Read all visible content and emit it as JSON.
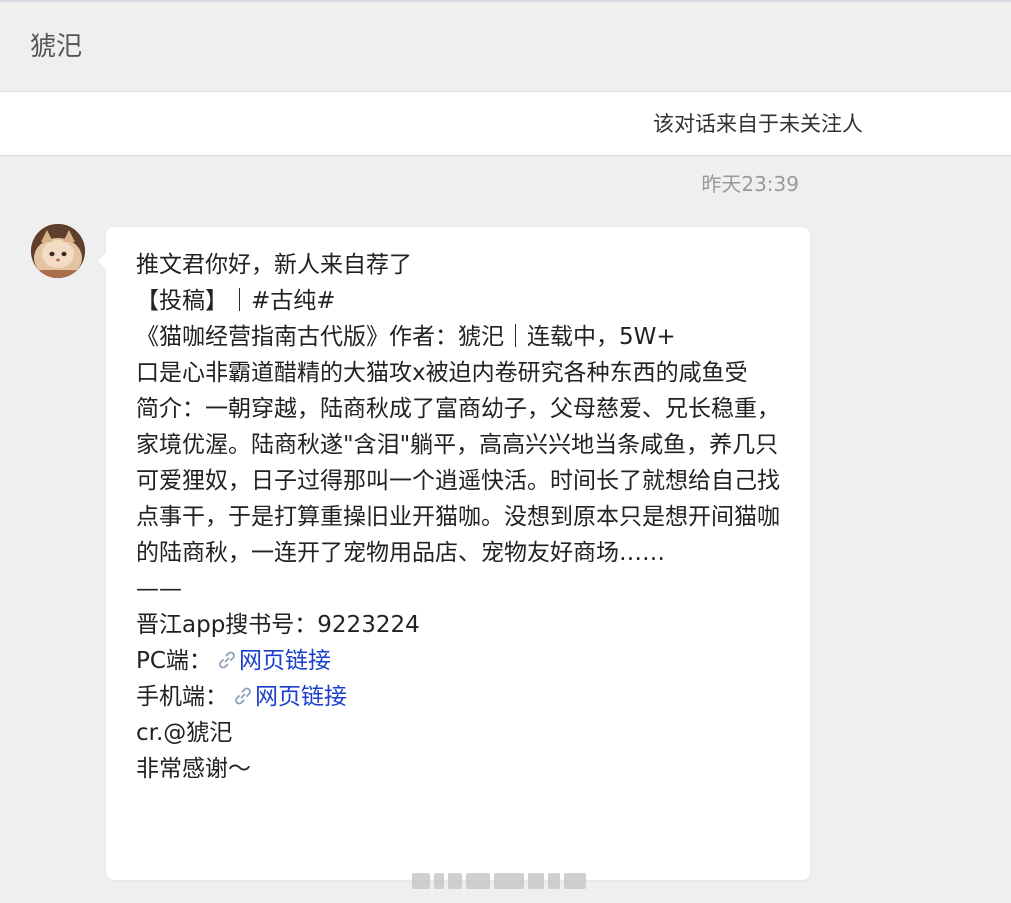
{
  "header": {
    "title": "猇汜"
  },
  "notice": {
    "text": "该对话来自于未关注人"
  },
  "message": {
    "timestamp": "昨天23:39",
    "lines": [
      "推文君你好，新人来自荐了",
      "【投稿】｜#古纯#",
      "《猫咖经营指南古代版》作者：猇汜｜连载中，5W+",
      "口是心非霸道醋精的大猫攻x被迫内卷研究各种东西的咸鱼受",
      "简介：一朝穿越，陆商秋成了富商幼子，父母慈爱、兄长稳重，家境优渥。陆商秋遂\"含泪\"躺平，高高兴兴地当条咸鱼，养几只可爱狸奴，日子过得那叫一个逍遥快活。时间长了就想给自己找点事干，于是打算重操旧业开猫咖。没想到原本只是想开间猫咖的陆商秋，一连开了宠物用品店、宠物友好商场……",
      "——",
      "晋江app搜书号：9223224"
    ],
    "pc_label": "PC端：",
    "pc_link": "网页链接",
    "mobile_label": "手机端：",
    "mobile_link": "网页链接",
    "tail_lines": [
      "cr.@猇汜",
      "非常感谢～"
    ]
  },
  "icons": {
    "avatar": "cat-avatar-icon",
    "link": "link-icon"
  },
  "colors": {
    "link": "#1a3fcc",
    "timestamp": "#999999",
    "background": "#efefef"
  }
}
